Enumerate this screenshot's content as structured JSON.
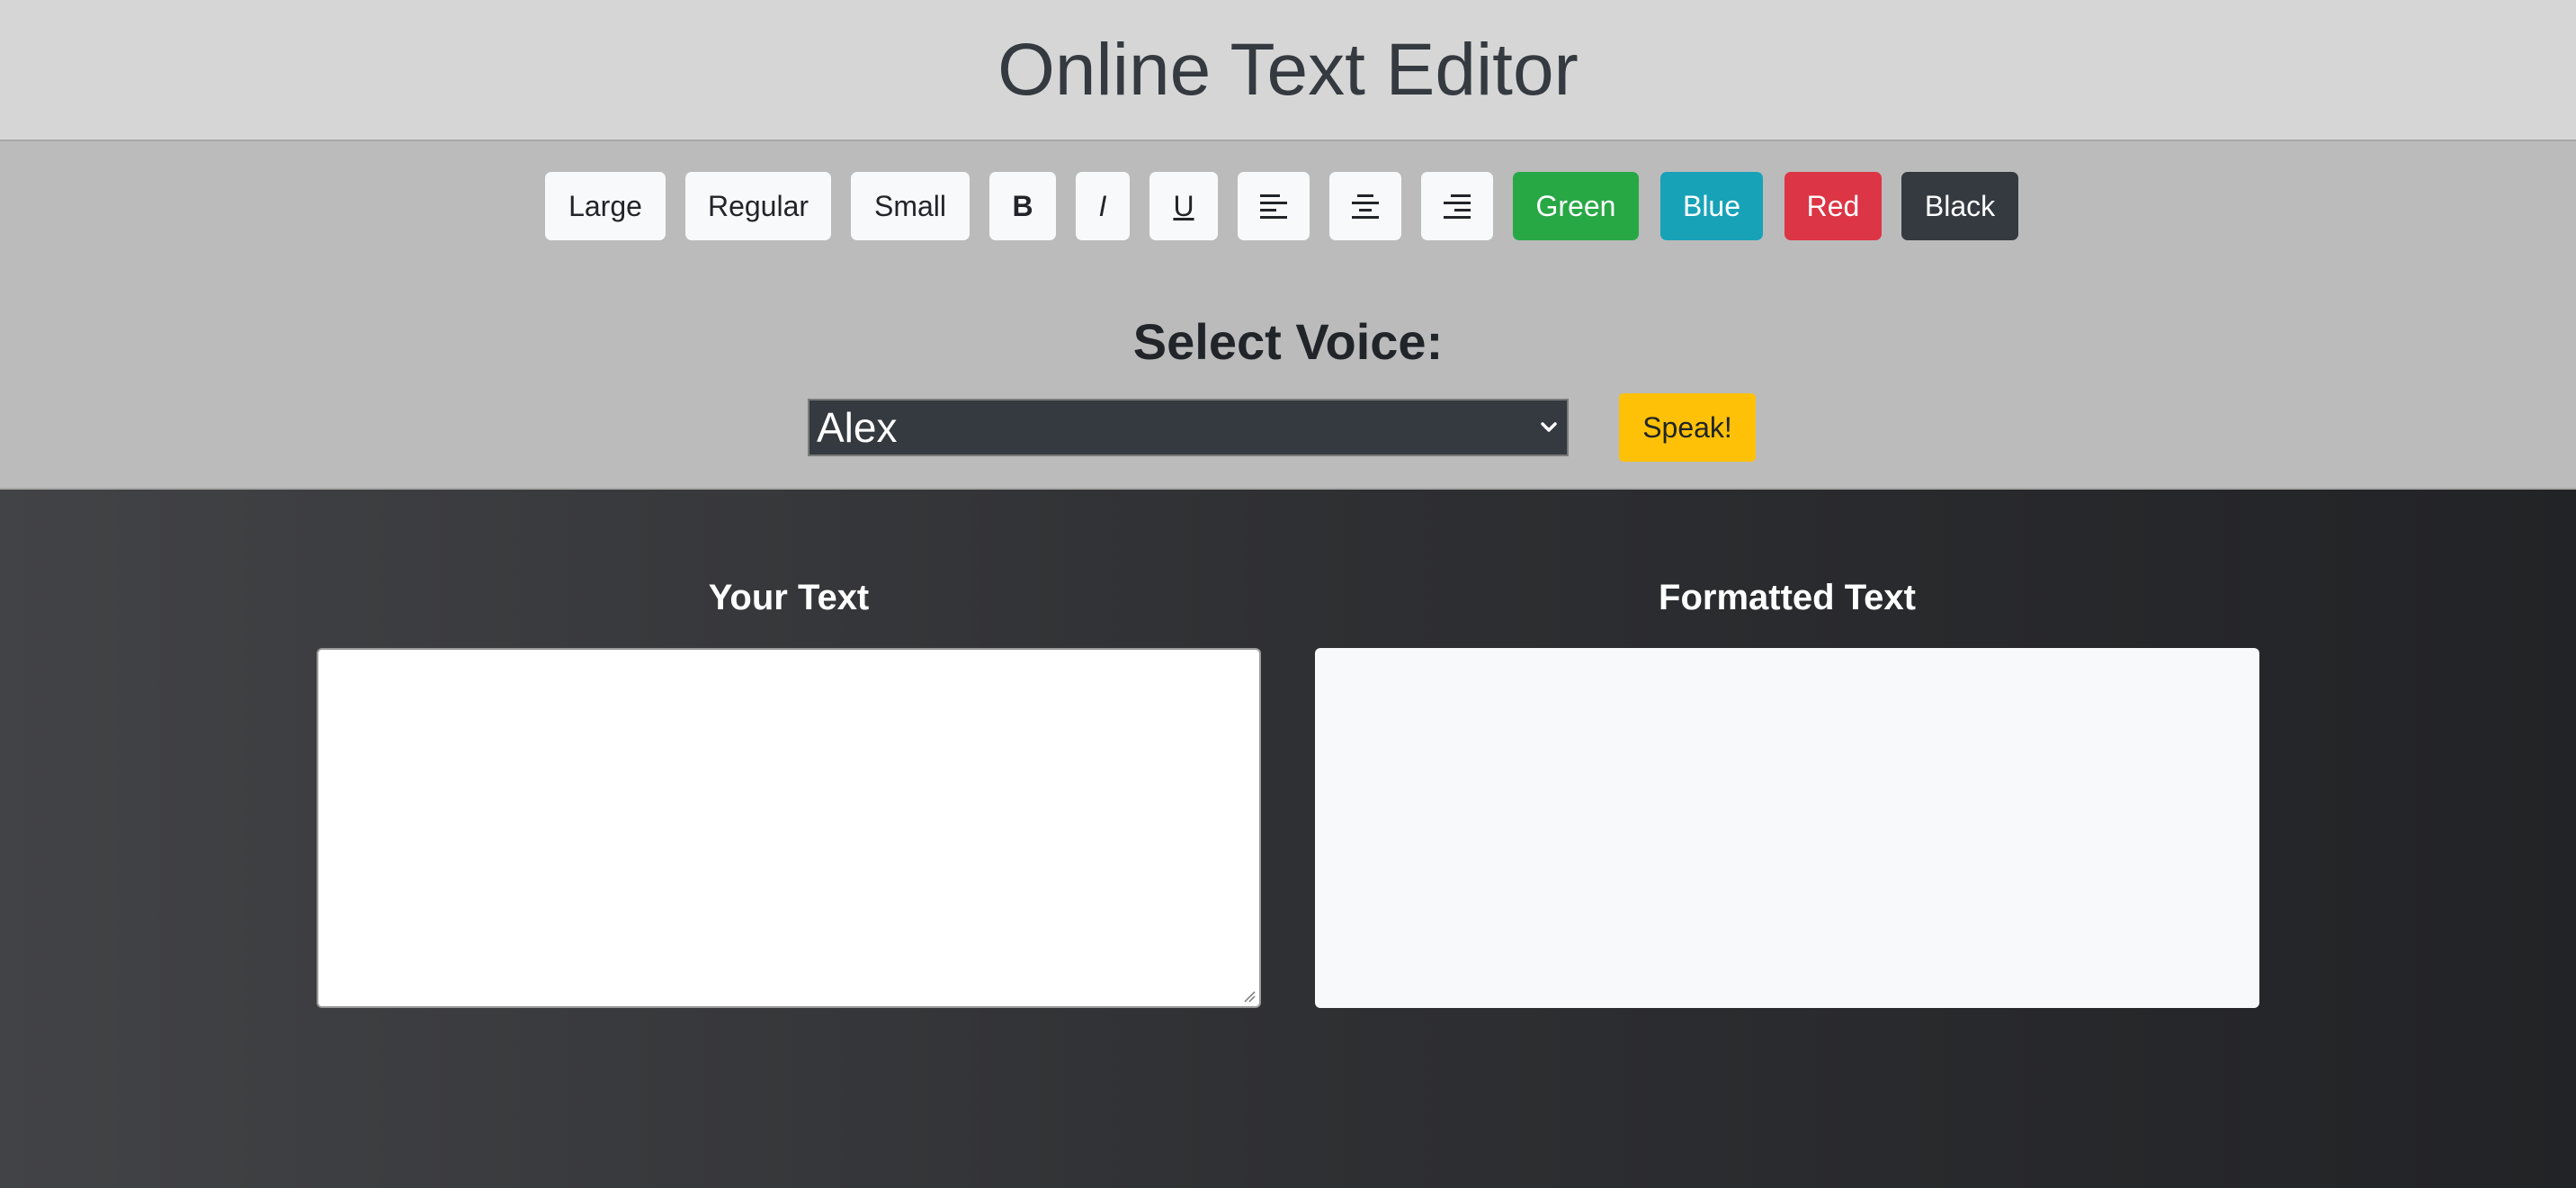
{
  "header": {
    "title": "Online Text Editor"
  },
  "toolbar": {
    "size_buttons": [
      "Large",
      "Regular",
      "Small"
    ],
    "style_buttons": {
      "bold": "B",
      "italic": "I",
      "underline": "U"
    },
    "align_buttons": [
      "align-left-icon",
      "align-center-icon",
      "align-right-icon"
    ],
    "color_buttons": [
      {
        "label": "Green",
        "color": "#28a745"
      },
      {
        "label": "Blue",
        "color": "#17a2b8"
      },
      {
        "label": "Red",
        "color": "#dc3545"
      },
      {
        "label": "Black",
        "color": "#343a40"
      }
    ]
  },
  "voice": {
    "label": "Select Voice:",
    "selected": "Alex",
    "speak_label": "Speak!"
  },
  "editor": {
    "input_title": "Your Text",
    "input_value": "",
    "output_title": "Formatted Text",
    "output_value": ""
  }
}
